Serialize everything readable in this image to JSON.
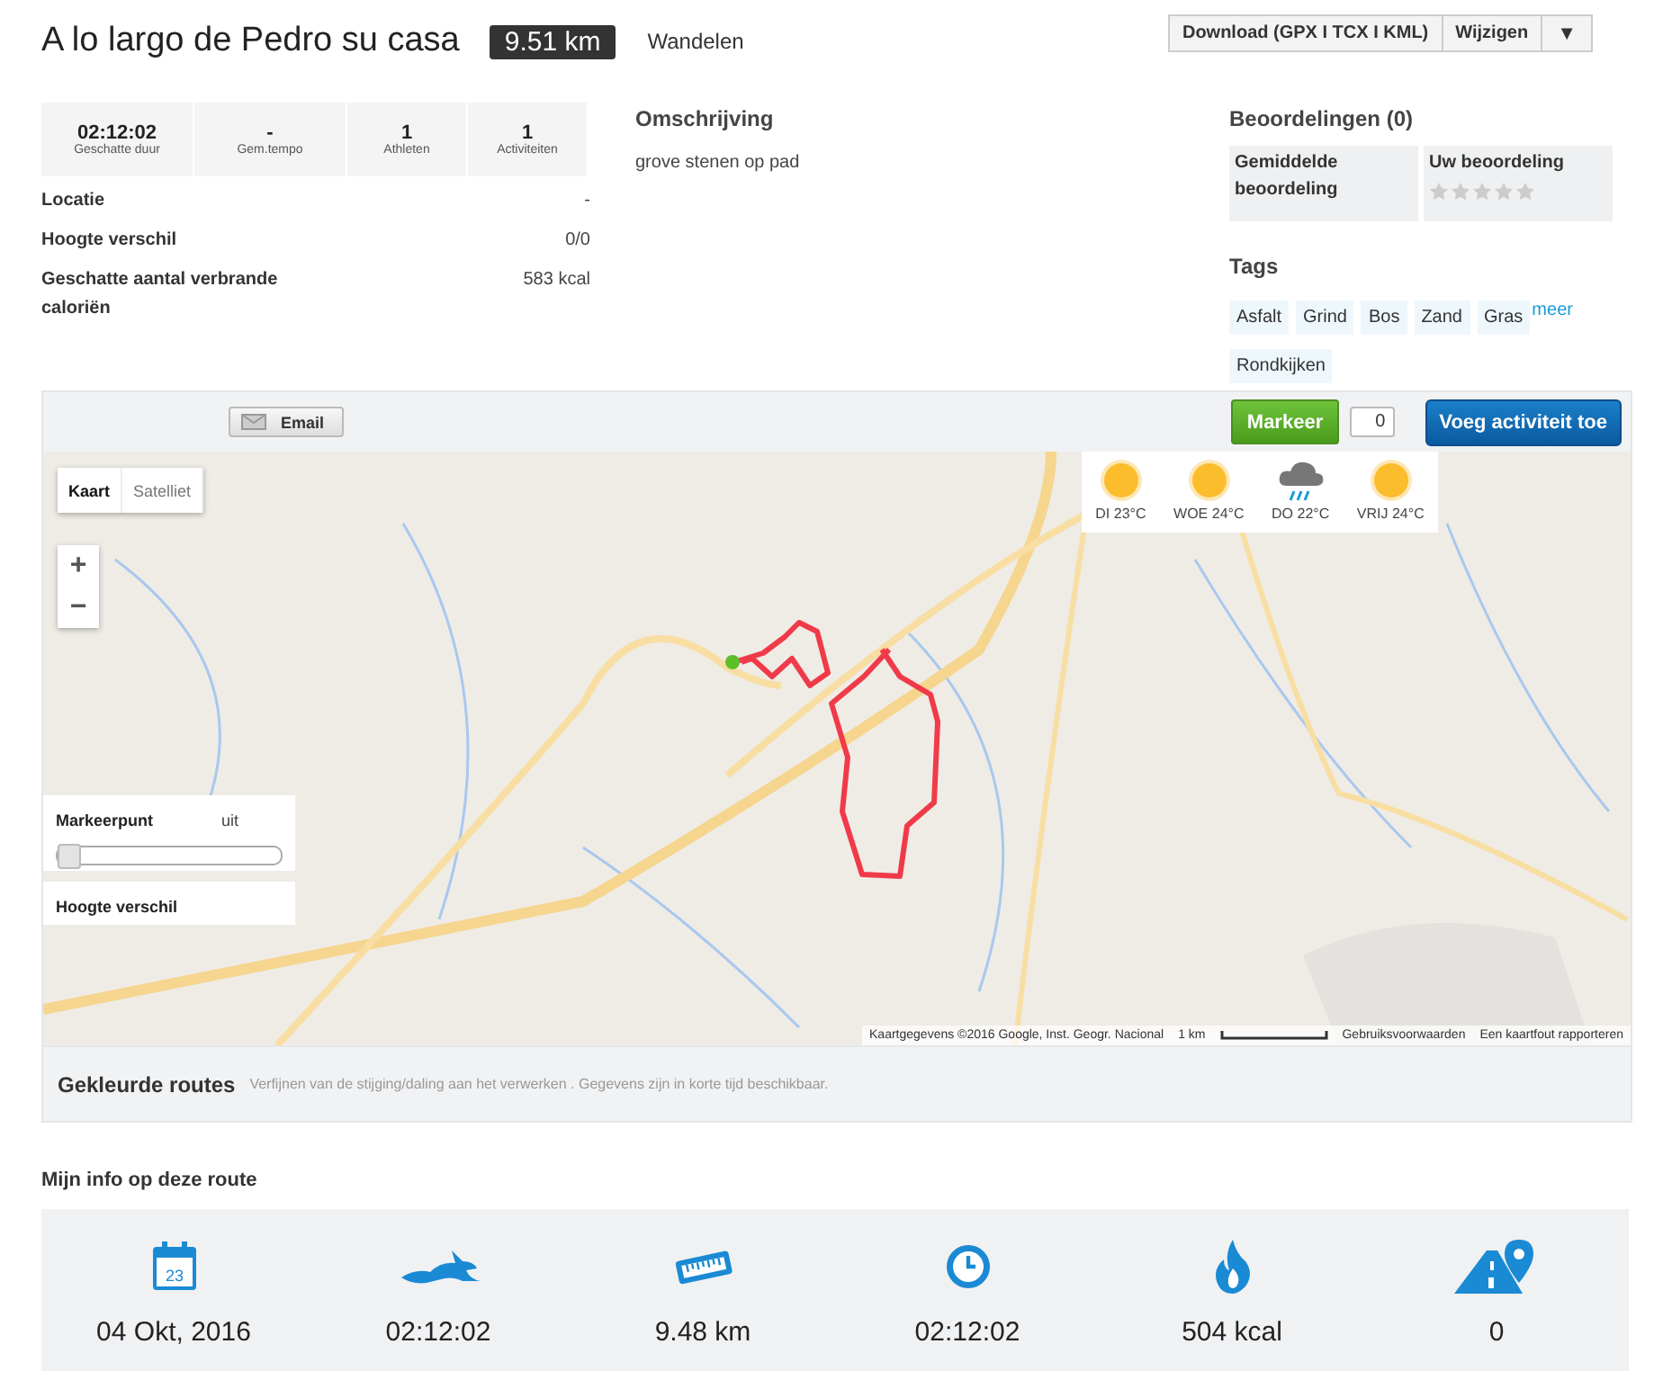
{
  "header": {
    "title": "A lo largo de Pedro su casa",
    "distance": "9.51 km",
    "activity_type": "Wandelen",
    "buttons": [
      {
        "label": "Download (GPX I TCX I KML)",
        "kind": "text"
      },
      {
        "label": "Wijzigen",
        "kind": "text"
      },
      {
        "label": "▼",
        "kind": "caret"
      }
    ]
  },
  "summary": {
    "stats": [
      {
        "value": "02:12:02",
        "label": "Geschatte duur"
      },
      {
        "value": "-",
        "label": "Gem.tempo"
      },
      {
        "value": "1",
        "label": "Athleten"
      },
      {
        "value": "1",
        "label": "Activiteiten"
      }
    ],
    "details": [
      {
        "label": "Locatie",
        "value": "-"
      },
      {
        "label": "Hoogte verschil",
        "value": "0/0"
      },
      {
        "label": "Geschatte aantal verbrande caloriën",
        "value": "583 kcal"
      }
    ]
  },
  "description": {
    "title": "Omschrijving",
    "text": "grove stenen op pad"
  },
  "ratings": {
    "title": "Beoordelingen (0)",
    "average_label": "Gemiddelde beoordeling",
    "own_label": "Uw beoordeling",
    "stars": 0
  },
  "tags": {
    "title": "Tags",
    "items": [
      "Asfalt",
      "Grind",
      "Bos",
      "Zand",
      "Gras"
    ],
    "more": "meer",
    "items_2": [
      "Rondkijken"
    ]
  },
  "map_toolbar": {
    "email": "Email",
    "mark": "Markeer",
    "mark_count": "0",
    "add_activity": "Voeg activiteit toe"
  },
  "map": {
    "types": [
      {
        "label": "Kaart",
        "selected": true
      },
      {
        "label": "Satelliet",
        "selected": false
      }
    ],
    "zoom_in": "+",
    "zoom_out": "−",
    "weather": [
      {
        "label": "DI 23°C",
        "kind": "sun"
      },
      {
        "label": "WOE 24°C",
        "kind": "sun"
      },
      {
        "label": "DO 22°C",
        "kind": "rain"
      },
      {
        "label": "VRIJ 24°C",
        "kind": "sun"
      }
    ],
    "marker": {
      "label": "Markeerpunt",
      "state": "uit",
      "level": 0
    },
    "elevation": "Hoogte verschil",
    "attribution": [
      "Kaartgegevens ©2016 Google, Inst. Geogr. Nacional",
      "1 km",
      "Gebruiksvoorwaarden",
      "Een kaartfout rapporteren"
    ]
  },
  "colored_routes": {
    "title": "Gekleurde routes",
    "note": "Verfijnen van de stijging/daling aan het verwerken . Gegevens zijn in korte tijd beschikbaar."
  },
  "my_info": {
    "title": "Mijn info op deze route",
    "items": [
      {
        "kind": "calendar",
        "icon_text": "23",
        "value": "04 Okt, 2016"
      },
      {
        "kind": "hare",
        "value": "02:12:02"
      },
      {
        "kind": "ruler",
        "value": "9.48 km"
      },
      {
        "kind": "clock",
        "value": "02:12:02"
      },
      {
        "kind": "flame",
        "value": "504 kcal"
      },
      {
        "kind": "road",
        "value": "0"
      }
    ]
  }
}
